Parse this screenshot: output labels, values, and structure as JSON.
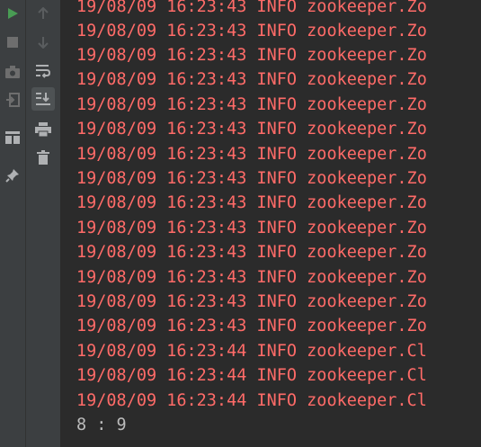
{
  "toolbar_left": {
    "buttons": [
      {
        "name": "run-icon",
        "color": "#499c54"
      },
      {
        "name": "stop-icon",
        "color": "#6e6e6e"
      },
      {
        "name": "camera-icon",
        "color": "#6e6e6e"
      },
      {
        "name": "exit-icon",
        "color": "#6e6e6e"
      },
      {
        "name": "layout-icon",
        "color": "#afb1b3"
      },
      {
        "name": "pin-icon",
        "color": "#afb1b3"
      }
    ]
  },
  "toolbar_right": {
    "buttons": [
      {
        "name": "arrow-up-icon"
      },
      {
        "name": "arrow-down-icon"
      },
      {
        "name": "soft-wrap-icon"
      },
      {
        "name": "scroll-to-end-icon",
        "active": true
      },
      {
        "name": "print-icon"
      },
      {
        "name": "trash-icon"
      }
    ]
  },
  "console": {
    "error_color": "#ff6b68",
    "lines": [
      "19/08/09 16:23:43 INFO zookeeper.Zo",
      "19/08/09 16:23:43 INFO zookeeper.Zo",
      "19/08/09 16:23:43 INFO zookeeper.Zo",
      "19/08/09 16:23:43 INFO zookeeper.Zo",
      "19/08/09 16:23:43 INFO zookeeper.Zo",
      "19/08/09 16:23:43 INFO zookeeper.Zo",
      "19/08/09 16:23:43 INFO zookeeper.Zo",
      "19/08/09 16:23:43 INFO zookeeper.Zo",
      "19/08/09 16:23:43 INFO zookeeper.Zo",
      "19/08/09 16:23:43 INFO zookeeper.Zo",
      "19/08/09 16:23:43 INFO zookeeper.Zo",
      "19/08/09 16:23:43 INFO zookeeper.Zo",
      "19/08/09 16:23:43 INFO zookeeper.Zo",
      "19/08/09 16:23:43 INFO zookeeper.Zo",
      "19/08/09 16:23:44 INFO zookeeper.Cl",
      "19/08/09 16:23:44 INFO zookeeper.Cl",
      "19/08/09 16:23:44 INFO zookeeper.Cl"
    ],
    "output_line": "8 : 9"
  }
}
